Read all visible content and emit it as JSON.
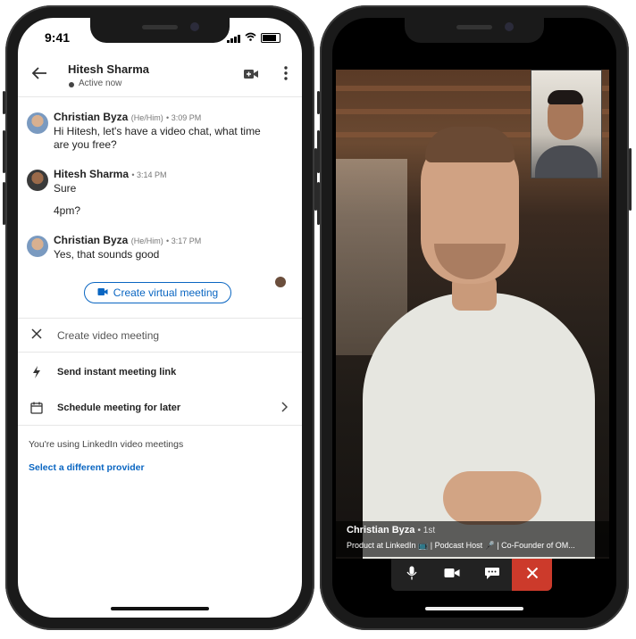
{
  "left_phone": {
    "status_time": "9:41",
    "header": {
      "name": "Hitesh Sharma",
      "status": "Active now"
    },
    "messages": [
      {
        "sender": "Christian Byza",
        "pronoun": "(He/Him)",
        "time": "• 3:09 PM",
        "lines": [
          "Hi Hitesh, let's have a video chat, what time",
          "are you free?"
        ]
      },
      {
        "sender": "Hitesh Sharma",
        "pronoun": "",
        "time": "• 3:14 PM",
        "lines": [
          "Sure"
        ]
      },
      {
        "sender": "",
        "pronoun": "",
        "time": "",
        "lines": [
          "4pm?"
        ]
      },
      {
        "sender": "Christian Byza",
        "pronoun": "(He/Him)",
        "time": "• 3:17 PM",
        "lines": [
          "Yes, that sounds good"
        ]
      }
    ],
    "create_virtual_meeting_label": "Create virtual meeting",
    "sheet": {
      "title": "Create video meeting",
      "instant_label": "Send instant meeting link",
      "schedule_label": "Schedule meeting for later",
      "info": "You're using LinkedIn video meetings",
      "provider_link": "Select a different provider"
    }
  },
  "right_phone": {
    "caption_name": "Christian Byza",
    "caption_degree": "• 1st",
    "caption_title": "Product at LinkedIn 📺 | Podcast Host 🎤 | Co-Founder of OM..."
  },
  "colors": {
    "accent": "#0a66c2",
    "end_call": "#cc3a2b"
  },
  "icons": [
    "back-arrow-icon",
    "video-call-icon",
    "more-options-icon",
    "close-icon",
    "lightning-icon",
    "calendar-icon",
    "chevron-right-icon",
    "mic-icon",
    "camera-icon",
    "chat-icon",
    "end-call-icon"
  ]
}
